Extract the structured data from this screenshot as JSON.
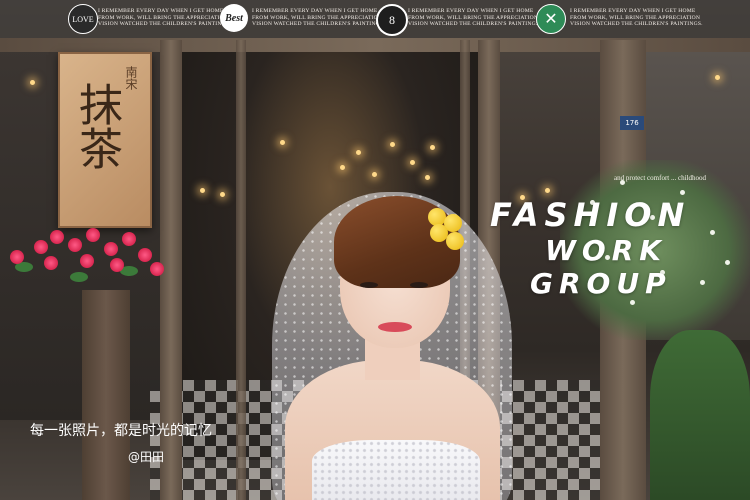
{
  "badges": [
    {
      "icon": "love-badge-icon",
      "label": "LOVE",
      "text": "I REMEMBER EVERY DAY WHEN I GET HOME FROM WORK, WILL BRING THE APPRECIATION VISION WATCHED THE CHILDREN'S PAINTINGS."
    },
    {
      "icon": "best-badge-icon",
      "label": "Best",
      "text": "I REMEMBER EVERY DAY WHEN I GET HOME FROM WORK, WILL BRING THE APPRECIATION VISION WATCHED THE CHILDREN'S PAINTINGS."
    },
    {
      "icon": "eight-badge-icon",
      "label": "8",
      "text": "I REMEMBER EVERY DAY WHEN I GET HOME FROM WORK, WILL BRING THE APPRECIATION VISION WATCHED THE CHILDREN'S PAINTINGS."
    },
    {
      "icon": "cross-badge-icon",
      "label": "",
      "text": "I REMEMBER EVERY DAY WHEN I GET HOME FROM WORK, WILL BRING THE APPRECIATION VISION WATCHED THE CHILDREN'S PAINTINGS."
    }
  ],
  "sign": {
    "main": "抹茶",
    "small": "南宋"
  },
  "plaque": "176",
  "headline": {
    "small": "and protect comfort ... childhood",
    "line1": "FASHION",
    "line2": "WORK",
    "line3": "GROUP"
  },
  "captions": {
    "line1": "每一张照片，都是时光的记忆",
    "line2": "@田田"
  },
  "colors": {
    "accent_green": "#2e8b57",
    "overlay": "#3c3a38",
    "lip": "#d84b5a"
  }
}
